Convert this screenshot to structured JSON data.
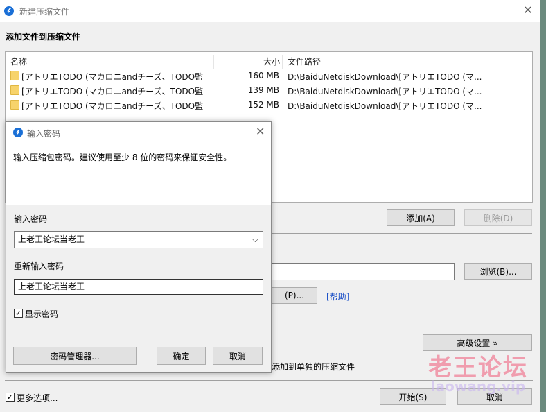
{
  "window": {
    "title": "新建压缩文件",
    "section_title": "添加文件到压缩文件",
    "columns": [
      "名称",
      "大小",
      "文件路径"
    ],
    "files": [
      {
        "name": "[アトリエTODO (マカロニandチーズ、TODO監",
        "size": "160 MB",
        "path": "D:\\BaiduNetdiskDownload\\[アトリエTODO (マ..."
      },
      {
        "name": "[アトリエTODO (マカロニandチーズ、TODO監",
        "size": "139 MB",
        "path": "D:\\BaiduNetdiskDownload\\[アトリエTODO (マ..."
      },
      {
        "name": "[アトリエTODO (マカロニandチーズ、TODO監",
        "size": "152 MB",
        "path": "D:\\BaiduNetdiskDownload\\[アトリエTODO (マ..."
      }
    ],
    "add_button": "添加(A)",
    "delete_button": "删除(D)",
    "browse_button": "浏览(B)...",
    "partial_button": "(P)...",
    "help_link": "[帮助]",
    "advanced_button": "高级设置 »",
    "separate_archive_text": "添加到单独的压缩文件",
    "more_options_label": "更多选项...",
    "more_options_checked": true,
    "start_button": "开始(S)",
    "cancel_button": "取消"
  },
  "dialog": {
    "title": "输入密码",
    "description": "输入压缩包密码。建议使用至少 8 位的密码来保证安全性。",
    "password_label": "输入密码",
    "password_value": "上老王论坛当老王",
    "reenter_label": "重新输入密码",
    "reenter_value": "上老王论坛当老王",
    "show_password_label": "显示密码",
    "show_password_checked": true,
    "manager_button": "密码管理器...",
    "ok_button": "确定",
    "cancel_button": "取消"
  },
  "watermark": {
    "cn": "老王论坛",
    "en": "laowang.vip"
  },
  "colors": {
    "accent": "#1a6fd6",
    "link": "#1a4fc7",
    "folder": "#f7d36b"
  }
}
